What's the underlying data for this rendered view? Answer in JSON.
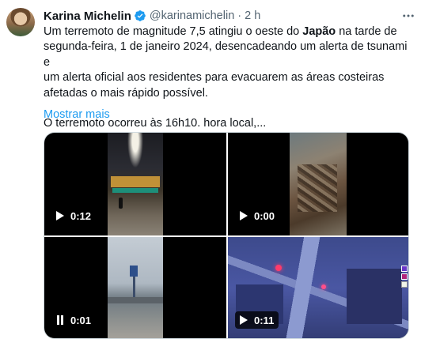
{
  "author": {
    "name": "Karina Michelin",
    "handle": "@karinamichelin",
    "separator": "·",
    "time": "2 h"
  },
  "icons": {
    "verified": "verified-badge-icon",
    "more": "more-horizontal-icon",
    "play": "play-icon",
    "pause": "pause-icon"
  },
  "post": {
    "text_line1_pre": "Um terremoto de magnitude 7,5 atingiu o oeste do ",
    "text_line1_bold": "Japão",
    "text_line1_post": " na tarde de",
    "text_line2": "segunda-feira, 1 de janeiro 2024, desencadeando um alerta de tsunami e",
    "text_line3": "um alerta oficial aos residentes para evacuarem as áreas costeiras",
    "text_line4": "afetadas o mais rápido possível.",
    "text_line5": "O terremoto ocorreu às 16h10. hora local,...",
    "show_more": "Mostrar mais"
  },
  "media": [
    {
      "duration": "0:12",
      "state": "play"
    },
    {
      "duration": "0:00",
      "state": "play"
    },
    {
      "duration": "0:01",
      "state": "pause"
    },
    {
      "duration": "0:11",
      "state": "play"
    }
  ],
  "colors": {
    "link": "#1d9bf0",
    "secondary_text": "#536471",
    "verified": "#1d9bf0"
  }
}
